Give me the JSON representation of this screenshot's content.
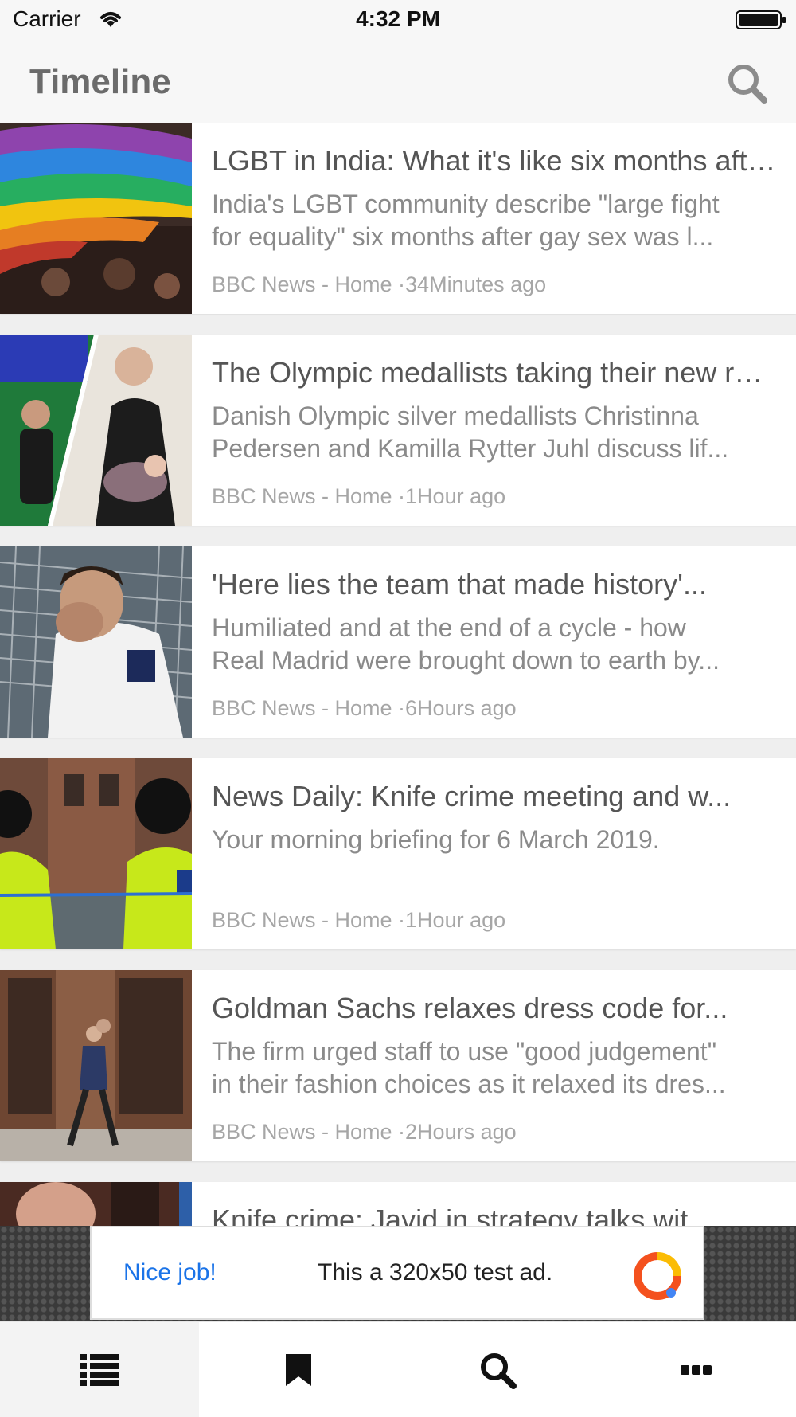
{
  "status_bar": {
    "carrier": "Carrier",
    "time": "4:32 PM"
  },
  "header": {
    "title": "Timeline"
  },
  "articles": [
    {
      "title": "LGBT in India: What it's like six months after gay sex was legalised",
      "summary_line1": "India's LGBT community describe \"large fight",
      "summary_line2": "for equality\" six months after gay sex was l...",
      "meta": "BBC News - Home ·34Minutes ago"
    },
    {
      "title": "The Olympic medallists taking their new roles",
      "summary_line1": "Danish Olympic silver medallists Christinna",
      "summary_line2": "Pedersen and Kamilla Rytter Juhl discuss lif...",
      "meta": "BBC News - Home ·1Hour ago"
    },
    {
      "title": "'Here lies the team that made history'...",
      "summary_line1": "Humiliated and at the end of a cycle - how",
      "summary_line2": "Real Madrid were brought down to earth by...",
      "meta": "BBC News - Home ·6Hours ago"
    },
    {
      "title": "News Daily: Knife crime meeting and w...",
      "summary_line1": "Your morning briefing for 6 March 2019.",
      "summary_line2": "",
      "meta": "BBC News - Home ·1Hour ago"
    },
    {
      "title": "Goldman Sachs relaxes dress code for...",
      "summary_line1": "The firm urged staff to use \"good judgement\"",
      "summary_line2": "in their fashion choices as it relaxed its dres...",
      "meta": "BBC News - Home ·2Hours ago"
    },
    {
      "title": "Knife crime: Javid in strategy talks wit",
      "summary_line1": "",
      "summary_line2": "",
      "meta": ""
    }
  ],
  "ad": {
    "cta": "Nice job!",
    "text": "This a 320x50 test ad."
  },
  "tab_bar": {
    "active_index": 0,
    "tabs": [
      {
        "icon": "list-icon"
      },
      {
        "icon": "bookmark-icon"
      },
      {
        "icon": "search-icon"
      },
      {
        "icon": "more-icon"
      }
    ]
  },
  "colors": {
    "title": "#555555",
    "summary": "#8a8a8a",
    "meta": "#a6a6a6",
    "ad_cta": "#1a73e8"
  }
}
